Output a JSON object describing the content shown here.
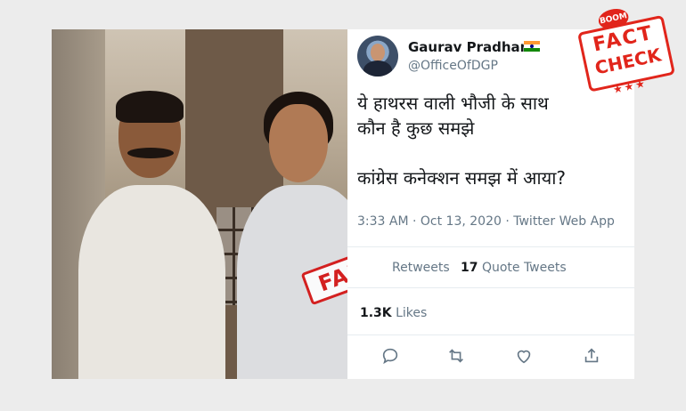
{
  "tweet": {
    "display_name": "Gaurav Pradhan",
    "flag_icon": "india-flag-icon",
    "handle": "@OfficeOfDGP",
    "text_line1": "ये हाथरस वाली भौजी के साथ",
    "text_line2": "कौन है कुछ समझे",
    "text_line3": "कांग्रेस कनेक्शन समझ में आया?",
    "timestamp": "3:33 AM · Oct 13, 2020 · Twitter Web App",
    "retweets_label": "Retweets",
    "quote_count": "17",
    "quote_label": "Quote Tweets",
    "likes_count": "1.3K",
    "likes_label": "Likes"
  },
  "overlays": {
    "fake_stamp": "FAKE",
    "factcheck_badge_top": "BOOM",
    "factcheck_line1": "FACT",
    "factcheck_line2": "CHECK",
    "factcheck_stars": "★★★"
  },
  "colors": {
    "stamp_red": "#d32020",
    "badge_red": "#e1251b",
    "text_primary": "#14171a",
    "text_secondary": "#657786"
  }
}
